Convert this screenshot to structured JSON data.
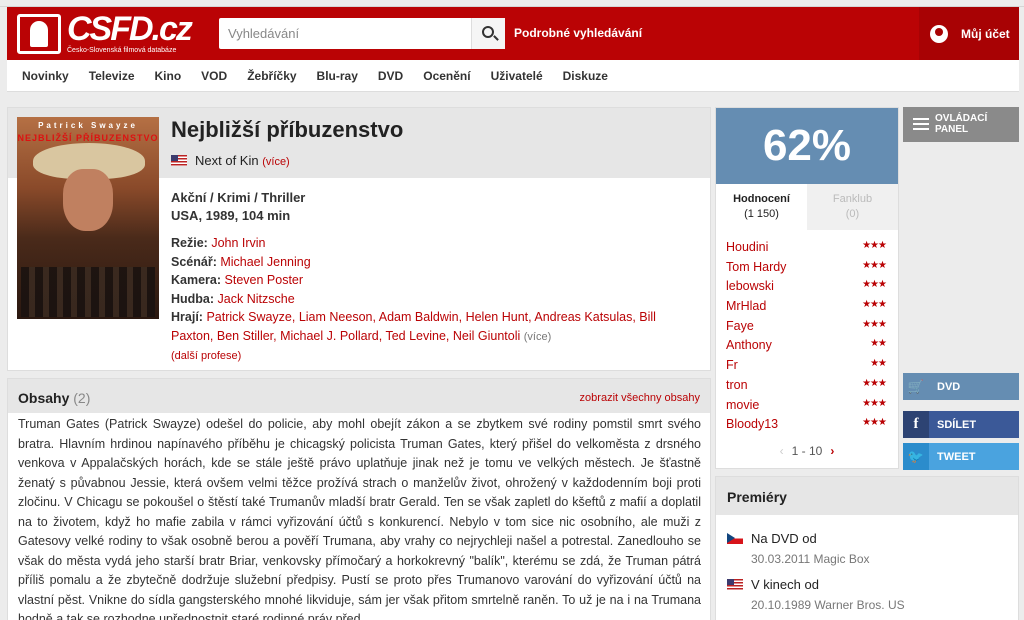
{
  "header": {
    "logo_text": "CSFD.cz",
    "logo_sub": "Česko-Slovenská filmová databáze",
    "search_placeholder": "Vyhledávání",
    "advanced_search": "Podrobné vyhledávání",
    "account": "Můj účet"
  },
  "nav": [
    "Novinky",
    "Televize",
    "Kino",
    "VOD",
    "Žebříčky",
    "Blu-ray",
    "DVD",
    "Ocenění",
    "Uživatelé",
    "Diskuze"
  ],
  "film": {
    "poster_actor": "Patrick Swayze",
    "poster_title": "NEJBLIŽŠÍ PŘÍBUZENSTVO",
    "title": "Nejbližší příbuzenstvo",
    "original_title": "Next of Kin",
    "more": "(více)",
    "genres": "Akční / Krimi / Thriller",
    "origin": "USA, 1989, 104 min",
    "director_label": "Režie:",
    "director": "John Irvin",
    "writer_label": "Scénář:",
    "writer": "Michael Jenning",
    "camera_label": "Kamera:",
    "camera": "Steven Poster",
    "music_label": "Hudba:",
    "music": "Jack Nitzsche",
    "cast_label": "Hrají:",
    "cast": "Patrick Swayze, Liam Neeson, Adam Baldwin, Helen Hunt, Andreas Katsulas, Bill Paxton, Ben Stiller, Michael J. Pollard, Ted Levine, Neil Giuntoli",
    "cast_more": "(více)",
    "more_professions": "(další profese)"
  },
  "plot": {
    "title": "Obsahy",
    "count": "(2)",
    "show_all": "zobrazit všechny obsahy",
    "text": "Truman Gates (Patrick Swayze) odešel do policie, aby mohl obejít zákon a se zbytkem své rodiny pomstil smrt svého bratra. Hlavním hrdinou napínavého příběhu je chicagský policista Truman Gates, který přišel do velkoměsta z drsného venkova v Appalačských horách, kde se stále ještě právo uplatňuje jinak než je tomu ve velkých městech. Je šťastně ženatý s půvabnou Jessie, která ovšem velmi těžce prožívá strach o manželův život, ohrožený v každodenním boji proti zločinu. V Chicagu se pokoušel o štěstí také Trumanův mladší bratr Gerald. Ten se však zapletl do kšeftů z mafií a doplatil na to životem, když ho mafie zabila v rámci vyřizování účtů s konkurencí. Nebylo v tom sice nic osobního, ale muži z Gatesovy velké rodiny to však osobně berou a pověří Trumana, aby vrahy co nejrychleji našel a potrestal. Zanedlouho se však do města vydá jeho starší bratr Briar, venkovsky přímočarý a horkokrevný \"balík\", kterému se zdá, že Truman pátrá příliš pomalu a že zbytečně dodržuje služební předpisy. Pustí se proto přes Trumanovo varování do vyřizování účtů na vlastní pěst. Vnikne do sídla gangsterského mnohé likviduje, sám jer však přitom smrtelně raněn. To už je na i na Trumana hodně a tak se rozhodne upřednostnit staré rodinné práv před"
  },
  "rating": {
    "percent": "62%",
    "tab_active": "Hodnocení",
    "tab_active_count": "(1 150)",
    "tab_inactive": "Fanklub",
    "tab_inactive_count": "(0)",
    "users": [
      {
        "name": "Houdini",
        "stars": "★★★"
      },
      {
        "name": "Tom Hardy",
        "stars": "★★★"
      },
      {
        "name": "lebowski",
        "stars": "★★★"
      },
      {
        "name": "MrHlad",
        "stars": "★★★"
      },
      {
        "name": "Faye",
        "stars": "★★★"
      },
      {
        "name": "Anthony",
        "stars": "★★"
      },
      {
        "name": "Fr",
        "stars": "★★"
      },
      {
        "name": "tron",
        "stars": "★★★"
      },
      {
        "name": "movie",
        "stars": "★★★"
      },
      {
        "name": "Bloody13",
        "stars": "★★★"
      }
    ],
    "pager": "1 - 10"
  },
  "premieres": {
    "title": "Premiéry",
    "items": [
      {
        "label": "Na DVD od",
        "detail": "30.03.2011 Magic Box",
        "flag": "cz"
      },
      {
        "label": "V kinech od",
        "detail": "20.10.1989 Warner Bros. US",
        "flag": "us"
      }
    ]
  },
  "side": {
    "control_panel": "OVLÁDACÍ PANEL",
    "dvd": "DVD",
    "share": "SDÍLET",
    "tweet": "TWEET"
  },
  "colors": {
    "brand_red": "#ba0305",
    "rating_blue": "#658db2",
    "facebook": "#3b5998",
    "twitter": "#4aa3df"
  }
}
